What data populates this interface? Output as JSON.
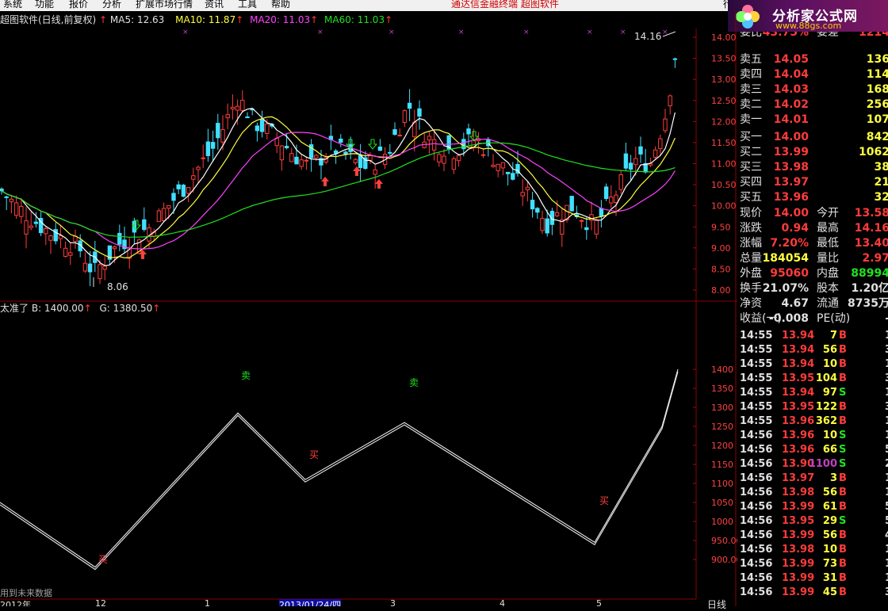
{
  "menu": {
    "items": [
      "系统",
      "功能",
      "报价",
      "分析",
      "扩展市场行情",
      "资讯",
      "工具",
      "帮助"
    ],
    "promo": "通达信金融终端   超图软件",
    "right_cut": "行"
  },
  "logo": {
    "text": "分析家公式网",
    "url": "www.88gs.com"
  },
  "title": {
    "app": "超图软件(日线,前复权)",
    "ma5": "MA5: 12.63",
    "ma10": "MA10: 11.87",
    "ma20": "MA20: 11.03",
    "ma60": "MA60: 11.03"
  },
  "price_axis": [
    "14.00",
    "13.50",
    "13.00",
    "12.50",
    "12.00",
    "11.50",
    "11.00",
    "10.50",
    "10.00",
    "9.50",
    "9.00",
    "8.50",
    "8.00"
  ],
  "price_labels": {
    "high": "14.16",
    "low": "8.06"
  },
  "indicator": {
    "name": "太准了",
    "b": "B: 1400.00",
    "g": "G: 1380.50",
    "axis": [
      "1400",
      "1350",
      "1300",
      "1250",
      "1200",
      "1150",
      "1100",
      "1050",
      "1000",
      "950.00",
      "900.00"
    ],
    "signals": {
      "buy": "买",
      "sell": "卖"
    },
    "footnote": "用到未来数据"
  },
  "time_axis": {
    "labels": [
      "2012年",
      "12",
      "1",
      "2013/01/24/四",
      "3",
      "4",
      "5"
    ],
    "period": "日线"
  },
  "quote": {
    "cut_top": {
      "left": "委比",
      "left_val": "43.75%",
      "right": "委差",
      "right_val": "1214"
    },
    "asks": [
      {
        "label": "卖五",
        "price": "14.05",
        "vol": "136"
      },
      {
        "label": "卖四",
        "price": "14.04",
        "vol": "114"
      },
      {
        "label": "卖三",
        "price": "14.03",
        "vol": "168"
      },
      {
        "label": "卖二",
        "price": "14.02",
        "vol": "256"
      },
      {
        "label": "卖一",
        "price": "14.01",
        "vol": "107"
      }
    ],
    "bids": [
      {
        "label": "买一",
        "price": "14.00",
        "vol": "842"
      },
      {
        "label": "买二",
        "price": "13.99",
        "vol": "1062"
      },
      {
        "label": "买三",
        "price": "13.98",
        "vol": "38"
      },
      {
        "label": "买四",
        "price": "13.97",
        "vol": "21"
      },
      {
        "label": "买五",
        "price": "13.96",
        "vol": "32"
      }
    ],
    "stats": [
      {
        "l1": "现价",
        "v1": "14.00",
        "c1": "red",
        "l2": "今开",
        "v2": "13.58",
        "c2": "red"
      },
      {
        "l1": "涨跌",
        "v1": "0.94",
        "c1": "red",
        "l2": "最高",
        "v2": "14.16",
        "c2": "red"
      },
      {
        "l1": "涨幅",
        "v1": "7.20%",
        "c1": "red",
        "l2": "最低",
        "v2": "13.40",
        "c2": "red"
      },
      {
        "l1": "总量",
        "v1": "184054",
        "c1": "yellow",
        "l2": "量比",
        "v2": "2.97",
        "c2": "red"
      },
      {
        "l1": "外盘",
        "v1": "95060",
        "c1": "red",
        "l2": "内盘",
        "v2": "88994",
        "c2": "green"
      },
      {
        "l1": "换手",
        "v1": "21.07%",
        "c1": "white",
        "l2": "股本",
        "v2": "1.20亿",
        "c2": "white"
      },
      {
        "l1": "净资",
        "v1": "4.67",
        "c1": "white",
        "l2": "流通",
        "v2": "8735万",
        "c2": "white"
      },
      {
        "l1": "收益(一)",
        "v1": "-0.008",
        "c1": "white",
        "l2": "PE(动)",
        "v2": "-",
        "c2": "white"
      }
    ],
    "ticks": [
      {
        "t": "14:55",
        "p": "13.94",
        "v": "7",
        "d": "B",
        "n": "1"
      },
      {
        "t": "14:55",
        "p": "13.94",
        "v": "56",
        "d": "B",
        "n": "3"
      },
      {
        "t": "14:55",
        "p": "13.94",
        "v": "10",
        "d": "B",
        "n": "1"
      },
      {
        "t": "14:55",
        "p": "13.95",
        "v": "104",
        "d": "B",
        "n": "3"
      },
      {
        "t": "14:55",
        "p": "13.94",
        "v": "97",
        "d": "S",
        "n": "1"
      },
      {
        "t": "14:55",
        "p": "13.95",
        "v": "122",
        "d": "B",
        "n": "3"
      },
      {
        "t": "14:55",
        "p": "13.96",
        "v": "362",
        "d": "B",
        "n": "15"
      },
      {
        "t": "14:56",
        "p": "13.96",
        "v": "10",
        "d": "S",
        "n": "1"
      },
      {
        "t": "14:56",
        "p": "13.96",
        "v": "66",
        "d": "S",
        "n": "5"
      },
      {
        "t": "14:56",
        "p": "13.90",
        "v": "1100",
        "d": "S",
        "n": "23"
      },
      {
        "t": "14:56",
        "p": "13.97",
        "v": "3",
        "d": "B",
        "n": "1"
      },
      {
        "t": "14:56",
        "p": "13.98",
        "v": "56",
        "d": "B",
        "n": "1"
      },
      {
        "t": "14:56",
        "p": "13.99",
        "v": "61",
        "d": "B",
        "n": "5"
      },
      {
        "t": "14:56",
        "p": "13.95",
        "v": "29",
        "d": "S",
        "n": "5"
      },
      {
        "t": "14:56",
        "p": "13.99",
        "v": "56",
        "d": "B",
        "n": "4"
      },
      {
        "t": "14:56",
        "p": "13.98",
        "v": "10",
        "d": "B",
        "n": "1"
      },
      {
        "t": "14:56",
        "p": "13.99",
        "v": "73",
        "d": "B",
        "n": "1"
      },
      {
        "t": "14:56",
        "p": "13.99",
        "v": "31",
        "d": "B",
        "n": "1"
      },
      {
        "t": "14:56",
        "p": "13.99",
        "v": "45",
        "d": "B",
        "n": "3"
      }
    ]
  },
  "colors": {
    "up": "#ff3b3b",
    "down": "#40e0ff",
    "ma5": "#ffffff",
    "ma10": "#ffff40",
    "ma20": "#ff40ff",
    "ma60": "#20e020"
  }
}
